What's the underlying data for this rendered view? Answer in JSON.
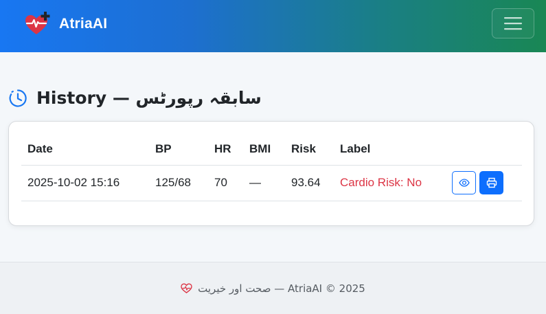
{
  "navbar": {
    "brand": "AtriaAI",
    "brand_color": "#dc3545",
    "toggler_icon": "hamburger-icon"
  },
  "page": {
    "heading": "History — سابقہ رپورٹس",
    "heading_icon": "clock-icon",
    "accent": "#1877f2"
  },
  "table": {
    "columns": [
      "Date",
      "BP",
      "HR",
      "BMI",
      "Risk",
      "Label",
      ""
    ],
    "rows": [
      {
        "date": "2025-10-02 15:16",
        "bp": "125/68",
        "hr": "70",
        "bmi": "—",
        "risk": "93.64",
        "label": "Cardio Risk: No",
        "label_color": "#dc3545",
        "actions": [
          "eye-icon",
          "printer-icon"
        ]
      }
    ]
  },
  "footer": {
    "text": "صحت اور خیریت — AtriaAI © 2025",
    "icon": "heart-pulse-icon"
  }
}
